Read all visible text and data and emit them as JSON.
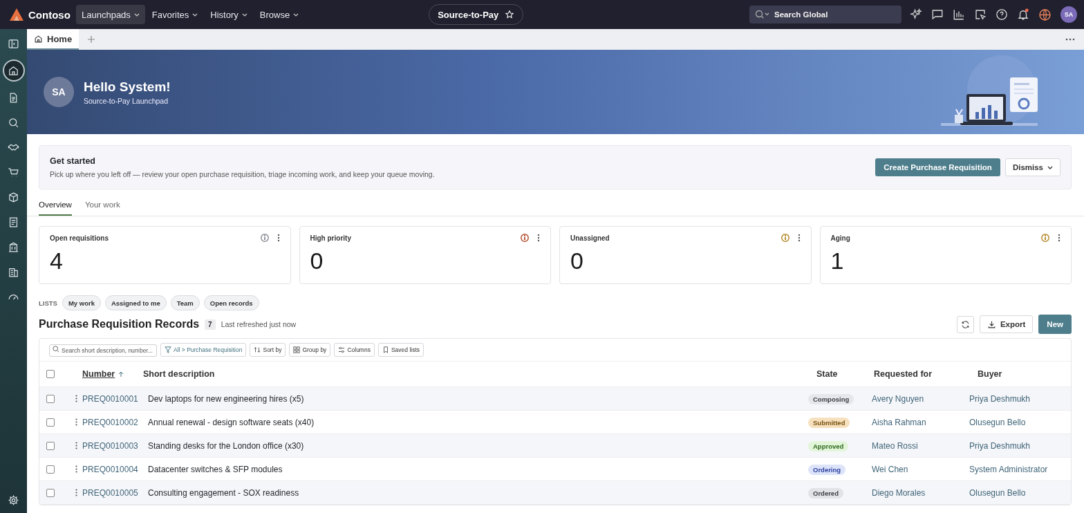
{
  "topbar": {
    "brand": "Contoso",
    "menus": [
      {
        "label": "Launchpads",
        "selected": true
      },
      {
        "label": "Favorites",
        "selected": false
      },
      {
        "label": "History",
        "selected": false
      },
      {
        "label": "Browse",
        "selected": false
      }
    ],
    "workspace": "Source-to-Pay",
    "search": {
      "placeholder": "Search Global"
    },
    "notification_unread": true,
    "avatar": "SA"
  },
  "sidebar": {
    "items": [
      {
        "selected": false
      },
      {
        "selected": true
      },
      {
        "selected": false
      },
      {
        "selected": false
      },
      {
        "selected": false
      },
      {
        "selected": false
      },
      {
        "selected": false
      },
      {
        "selected": false
      },
      {
        "selected": false
      },
      {
        "selected": false
      },
      {
        "selected": false
      }
    ]
  },
  "tabs": [
    {
      "label": "Home",
      "selected": true
    }
  ],
  "banner": {
    "avatar": "SA",
    "title": "Hello System!",
    "subtitle": "Source-to-Pay Launchpad"
  },
  "get_started": {
    "title": "Get started",
    "text": "Pick up where you left off — review your open purchase requisition, triage incoming work, and keep your queue moving.",
    "primary": "Create Purchase Requisition",
    "secondary": "Dismiss"
  },
  "view_tabs": [
    {
      "label": "Overview",
      "selected": true
    },
    {
      "label": "Your work",
      "selected": false
    }
  ],
  "metrics": [
    {
      "label": "Open requisitions",
      "value": "4",
      "color": "#8a8f98"
    },
    {
      "label": "High priority",
      "value": "0",
      "color": "#b5502e"
    },
    {
      "label": "Unassigned",
      "value": "0",
      "color": "#b58a2e"
    },
    {
      "label": "Aging",
      "value": "1",
      "color": "#b58a2e"
    }
  ],
  "lists": {
    "label": "LISTS",
    "chips": [
      "My work",
      "Assigned to me",
      "Team",
      "Open records"
    ]
  },
  "records": {
    "title": "Purchase Requisition Records",
    "count": "7",
    "refreshed": "Last refreshed just now",
    "export": "Export",
    "new": "New",
    "search": {
      "placeholder": "Search short description, number..."
    },
    "filter": "All > Purchase Requisition",
    "tools": [
      "Sort by",
      "Group by",
      "Columns",
      "Saved lists"
    ],
    "all_checked": false,
    "columns": [
      "Number",
      "Short description",
      "State",
      "Requested for",
      "Buyer"
    ],
    "rows": [
      {
        "checked": false,
        "number": "PREQ0010001",
        "description": "Dev laptops for new engineering hires (x5)",
        "state": "Composing",
        "color": "#e6e7ea",
        "requested_for": "Avery Nguyen",
        "buyer": "Priya Deshmukh"
      },
      {
        "checked": false,
        "number": "PREQ0010002",
        "description": "Annual renewal - design software seats (x40)",
        "state": "Submitted",
        "color": "#f6e0bd",
        "requested_for": "Aisha Rahman",
        "buyer": "Olusegun Bello"
      },
      {
        "checked": false,
        "number": "PREQ0010003",
        "description": "Standing desks for the London office (x30)",
        "state": "Approved",
        "color": "#e2f5d9",
        "requested_for": "Mateo Rossi",
        "buyer": "Priya Deshmukh"
      },
      {
        "checked": false,
        "number": "PREQ0010004",
        "description": "Datacenter switches & SFP modules",
        "state": "Ordering",
        "color": "#dde4fa",
        "requested_for": "Wei Chen",
        "buyer": "System Administrator"
      },
      {
        "checked": false,
        "number": "PREQ0010005",
        "description": "Consulting engagement - SOX readiness",
        "state": "Ordered",
        "color": "#e2e3e6",
        "requested_for": "Diego Morales",
        "buyer": "Olusegun Bello"
      }
    ]
  }
}
